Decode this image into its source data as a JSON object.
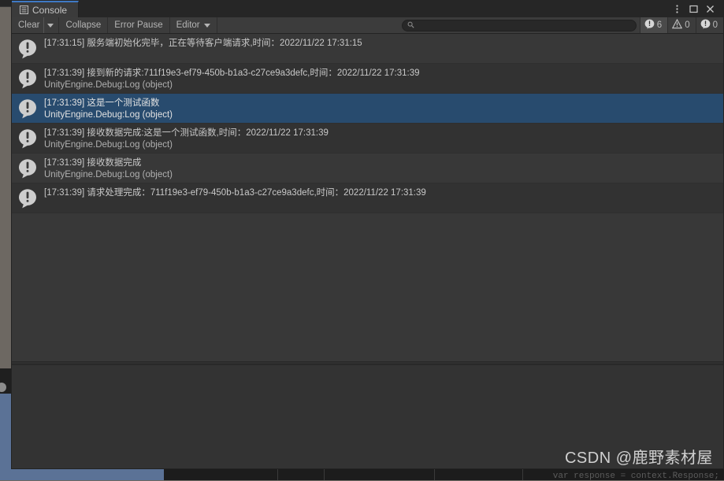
{
  "window": {
    "tab_label": "Console",
    "tab_icon": "list-icon",
    "controls": [
      {
        "name": "window-menu-button",
        "icon": "kebab-menu-icon"
      },
      {
        "name": "window-maximize-button",
        "icon": "maximize-icon"
      },
      {
        "name": "window-close-button",
        "icon": "close-icon"
      }
    ]
  },
  "toolbar": {
    "clear_label": "Clear",
    "clear_dropdown_icon": "chevron-down-icon",
    "collapse_label": "Collapse",
    "error_pause_label": "Error Pause",
    "editor_label": "Editor",
    "editor_dropdown_icon": "chevron-down-icon"
  },
  "search": {
    "icon": "search-icon",
    "value": "",
    "placeholder": ""
  },
  "counters": [
    {
      "name": "error-counter",
      "icon": "error-icon",
      "count": "6",
      "active": true
    },
    {
      "name": "warning-counter",
      "icon": "warning-icon",
      "count": "0",
      "active": false
    },
    {
      "name": "info-counter",
      "icon": "info-icon",
      "count": "0",
      "active": false
    }
  ],
  "logs": [
    {
      "icon": "log-error-icon",
      "line1": "[17:31:15] 服务端初始化完毕，正在等待客户端请求,时间：2022/11/22 17:31:15",
      "line2": "",
      "selected": false
    },
    {
      "icon": "log-error-icon",
      "line1": "[17:31:39] 接到新的请求:711f19e3-ef79-450b-b1a3-c27ce9a3defc,时间：2022/11/22 17:31:39",
      "line2": "UnityEngine.Debug:Log (object)",
      "selected": false
    },
    {
      "icon": "log-error-icon",
      "line1": "[17:31:39] 这是一个测试函数",
      "line2": "UnityEngine.Debug:Log (object)",
      "selected": true
    },
    {
      "icon": "log-error-icon",
      "line1": "[17:31:39] 接收数据完成:这是一个测试函数,时间：2022/11/22 17:31:39",
      "line2": "UnityEngine.Debug:Log (object)",
      "selected": false
    },
    {
      "icon": "log-error-icon",
      "line1": "[17:31:39] 接收数据完成",
      "line2": "UnityEngine.Debug:Log (object)",
      "selected": false
    },
    {
      "icon": "log-error-icon",
      "line1": "[17:31:39] 请求处理完成：711f19e3-ef79-450b-b1a3-c27ce9a3defc,时间：2022/11/22 17:31:39",
      "line2": "",
      "selected": false
    }
  ],
  "background": {
    "code_snippet": "var response = context.Response;"
  },
  "watermark": {
    "text": "CSDN @鹿野素材屋"
  },
  "colors": {
    "selection_blue": "#284b6e",
    "tab_accent": "#3f79c4",
    "window_bg": "#383838",
    "toolbar_bg": "#3c3c3c",
    "desktop_bg": "#6d6862"
  }
}
